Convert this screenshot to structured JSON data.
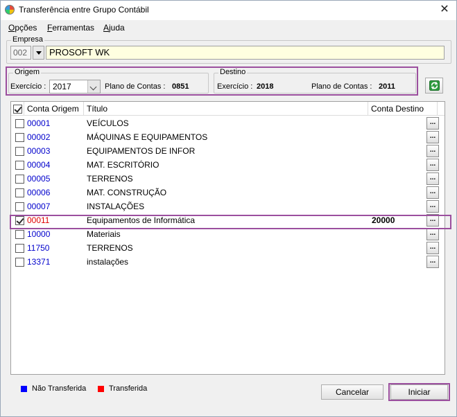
{
  "window": {
    "title": "Transferência entre Grupo Contábil"
  },
  "menu": [
    "Opções",
    "Ferramentas",
    "Ajuda"
  ],
  "empresa": {
    "legend": "Empresa",
    "code": "002",
    "name": "PROSOFT WK"
  },
  "origem": {
    "legend": "Origem",
    "exercicio_label": "Exercício :",
    "exercicio_value": "2017",
    "plano_label": "Plano de Contas :",
    "plano_value": "0851"
  },
  "destino": {
    "legend": "Destino",
    "exercicio_label": "Exercício :",
    "exercicio_value": "2018",
    "plano_label": "Plano de Contas :",
    "plano_value": "2011"
  },
  "grid": {
    "headers": {
      "conta_origem": "Conta Origem",
      "titulo": "Título",
      "conta_destino": "Conta Destino"
    },
    "dots_label": "...",
    "rows": [
      {
        "code": "00001",
        "title": "VEÍCULOS",
        "dest": "",
        "checked": false,
        "transferred": false
      },
      {
        "code": "00002",
        "title": "MÁQUINAS E EQUIPAMENTOS",
        "dest": "",
        "checked": false,
        "transferred": false
      },
      {
        "code": "00003",
        "title": "EQUIPAMENTOS DE INFOR",
        "dest": "",
        "checked": false,
        "transferred": false
      },
      {
        "code": "00004",
        "title": "MAT. ESCRITÓRIO",
        "dest": "",
        "checked": false,
        "transferred": false
      },
      {
        "code": "00005",
        "title": "TERRENOS",
        "dest": "",
        "checked": false,
        "transferred": false
      },
      {
        "code": "00006",
        "title": "MAT. CONSTRUÇÃO",
        "dest": "",
        "checked": false,
        "transferred": false
      },
      {
        "code": "00007",
        "title": "INSTALAÇÕES",
        "dest": "",
        "checked": false,
        "transferred": false
      },
      {
        "code": "00011",
        "title": "Equipamentos de Informática",
        "dest": "20000",
        "checked": true,
        "transferred": true
      },
      {
        "code": "10000",
        "title": "Materiais",
        "dest": "",
        "checked": false,
        "transferred": false
      },
      {
        "code": "11750",
        "title": "TERRENOS",
        "dest": "",
        "checked": false,
        "transferred": false
      },
      {
        "code": "13371",
        "title": "instalações",
        "dest": "",
        "checked": false,
        "transferred": false
      }
    ]
  },
  "legend_items": [
    {
      "label": "Não Transferida",
      "color": "#0000ff"
    },
    {
      "label": "Transferida",
      "color": "#ff0000"
    }
  ],
  "buttons": {
    "cancel": "Cancelar",
    "start": "Iniciar"
  },
  "colors": {
    "highlight": "#9b4f9e",
    "not_transferred": "#0000cc",
    "transferred": "#e00000"
  }
}
